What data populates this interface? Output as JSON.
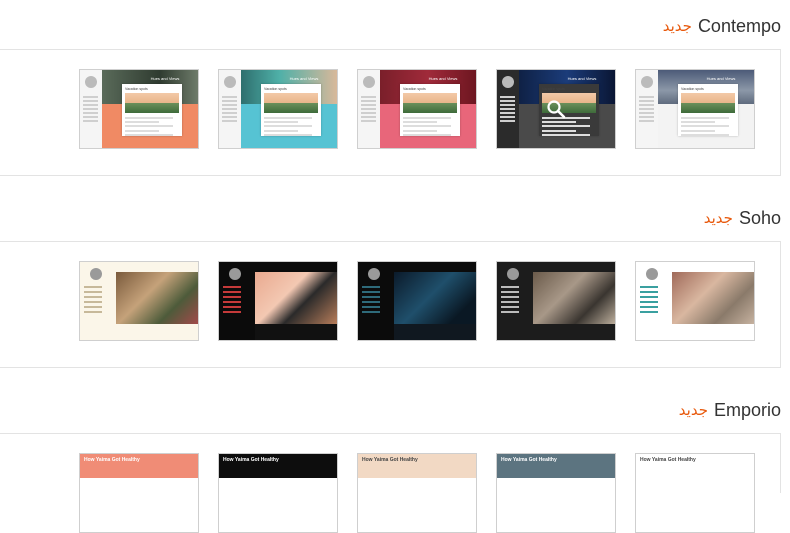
{
  "sections": [
    {
      "id": "contempo",
      "title": "Contempo",
      "badge": "جديد",
      "thumbs": [
        {
          "hero_title": "Hues and Views",
          "card_title": "Vacation spots",
          "side_bg": "#f5f5f5",
          "bottom_color": "#f08a64",
          "hero": "linear-gradient(90deg,#5a6b5a,#2f3b30 60%,#6e7b6a)"
        },
        {
          "hero_title": "Hues and Views",
          "card_title": "Vacation spots",
          "side_bg": "#f5f5f5",
          "bottom_color": "#56c3d3",
          "hero": "linear-gradient(90deg,#2e6f6e,#4fb0a8 40%,#d8b89a)"
        },
        {
          "hero_title": "Hues and Views",
          "card_title": "Vacation spots",
          "side_bg": "#f5f5f5",
          "bottom_color": "#e8667a",
          "hero": "linear-gradient(90deg,#7a1f2a,#a02a3a 50%,#6d1620)"
        },
        {
          "hero_title": "Hues and Views",
          "card_title": "Vacation spots",
          "side_bg": "#2b2b2b",
          "bottom_color": "#4a4a4a",
          "hero": "linear-gradient(90deg,#0f2145,#1b3c7a 50%,#0a1634)"
        },
        {
          "hero_title": "Hues and Views",
          "card_title": "Vacation spots",
          "side_bg": "#f5f5f5",
          "bottom_color": "#f3f3f3",
          "hero": "linear-gradient(180deg,#4c5b78,#8c98a8 60%,#5f6b7e)"
        }
      ]
    },
    {
      "id": "soho",
      "title": "Soho",
      "badge": "جديد",
      "thumbs": [
        {
          "side": "#fbf6e9",
          "head": "#fbf6e9",
          "img": "linear-gradient(135deg,#7a5a3c,#c5a27a 40%,#4d5b3a 70%,#a14a4a)",
          "bot": "#fbf6e9",
          "text": "#c7b99a"
        },
        {
          "side": "#0b0b0b",
          "head": "#0b0b0b",
          "img": "linear-gradient(135deg,#e9a98f,#f3c8b2 40%,#2a2a2a 60%,#b77d5a)",
          "bot": "#111",
          "text": "#c53a3a"
        },
        {
          "side": "#0b0b0b",
          "head": "#0b0b0b",
          "img": "linear-gradient(135deg,#0b1a2a,#1f4f6b 45%,#0a1824 80%)",
          "bot": "#101820",
          "text": "#2e6a7a"
        },
        {
          "side": "#1c1c1c",
          "head": "#1c1c1c",
          "img": "linear-gradient(135deg,#6a5a4a,#a89888 40%,#3a3530 70%,#bcae9c)",
          "bot": "#1c1c1c",
          "text": "#bbbbbb"
        },
        {
          "side": "#ffffff",
          "head": "#ffffff",
          "img": "linear-gradient(135deg,#a06a5a,#d9b7a0 40%,#8a7a6a 70%,#c6b2a0)",
          "bot": "#ffffff",
          "text": "#3aa0a0"
        }
      ]
    },
    {
      "id": "emporio",
      "title": "Emporio",
      "badge": "جديد",
      "thumbs": [
        {
          "head": "#f08c76",
          "title": "How Yaima Got Healthy",
          "title_color": "#ffffff"
        },
        {
          "head": "#0d0d0d",
          "title": "How Yaima Got Healthy",
          "title_color": "#ffffff"
        },
        {
          "head": "#f2d9c4",
          "title": "How Yaima Got Healthy",
          "title_color": "#444444"
        },
        {
          "head": "#5c7480",
          "title": "How Yaima Got Healthy",
          "title_color": "#ffffff"
        },
        {
          "head": "#ffffff",
          "title": "How Yaima Got Healthy",
          "title_color": "#444444"
        }
      ]
    }
  ]
}
